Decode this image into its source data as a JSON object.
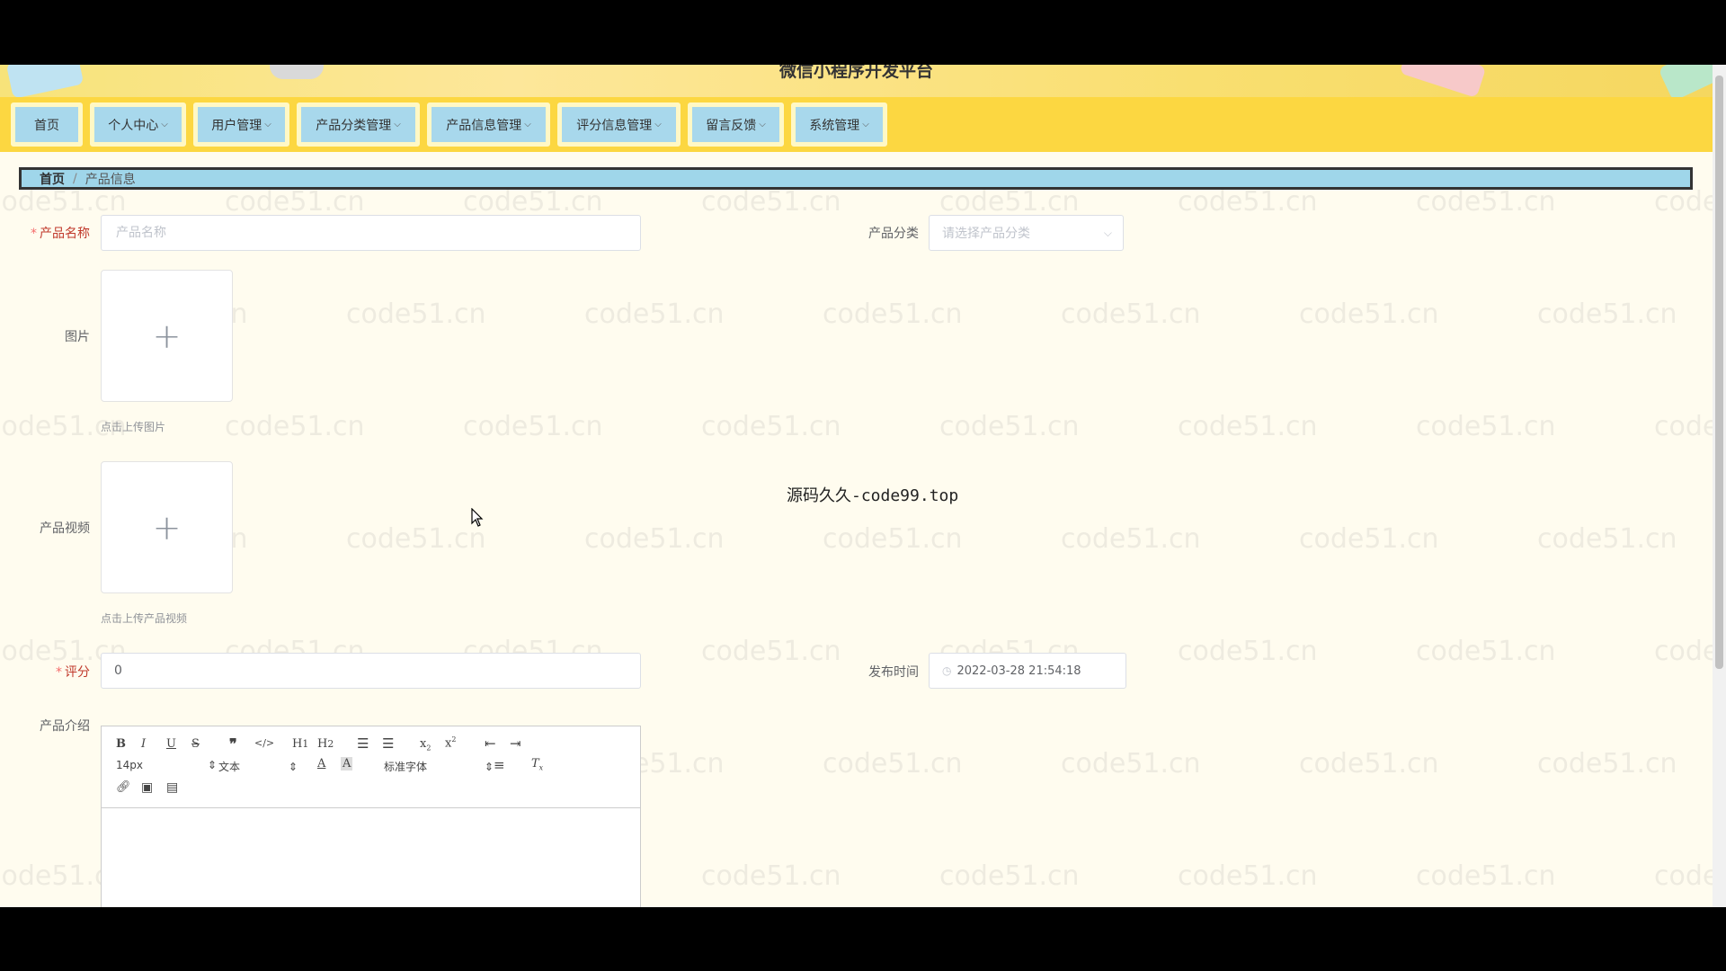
{
  "header": {
    "title": "微信小程序开发平台"
  },
  "nav": {
    "items": [
      {
        "label": "首页",
        "dropdown": false
      },
      {
        "label": "个人中心",
        "dropdown": true
      },
      {
        "label": "用户管理",
        "dropdown": true
      },
      {
        "label": "产品分类管理",
        "dropdown": true
      },
      {
        "label": "产品信息管理",
        "dropdown": true
      },
      {
        "label": "评分信息管理",
        "dropdown": true
      },
      {
        "label": "留言反馈",
        "dropdown": true
      },
      {
        "label": "系统管理",
        "dropdown": true
      }
    ]
  },
  "breadcrumb": {
    "home": "首页",
    "separator": "/",
    "current": "产品信息"
  },
  "form": {
    "product_name": {
      "label": "产品名称",
      "required": true,
      "placeholder": "产品名称",
      "value": ""
    },
    "product_category": {
      "label": "产品分类",
      "placeholder": "请选择产品分类"
    },
    "image": {
      "label": "图片",
      "hint": "点击上传图片"
    },
    "video": {
      "label": "产品视频",
      "hint": "点击上传产品视频"
    },
    "rating": {
      "label": "评分",
      "required": true,
      "value": "0"
    },
    "publish_time": {
      "label": "发布时间",
      "value": "2022-03-28 21:54:18"
    },
    "description": {
      "label": "产品介绍",
      "font_size": "14px",
      "text_style": "文本",
      "font_family": "标准字体"
    }
  },
  "watermark_text": "code51.cn",
  "center_text": "源码久久-code99.top",
  "colors": {
    "nav_bg": "#fcd741",
    "nav_item_bg": "#a8d8ec",
    "page_bg": "#fffcef",
    "breadcrumb_bg": "#9fd6ea"
  }
}
